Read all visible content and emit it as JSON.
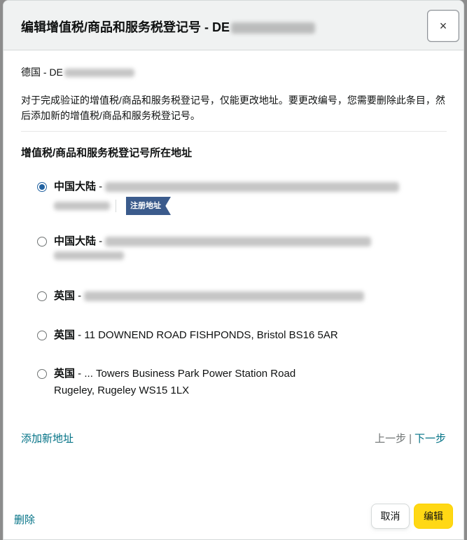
{
  "header": {
    "title": "编辑增值税/商品和服务税登记号 - DE",
    "close_glyph": "×"
  },
  "country_line": "德国 - DE",
  "note": "对于完成验证的增值税/商品和服务税登记号，仅能更改地址。要更改编号，您需要删除此条目，然后添加新的增值税/商品和服务税登记号。",
  "section_title": "增值税/商品和服务税登记号所在地址",
  "addresses": [
    {
      "country": "中国大陆",
      "dash": " - ",
      "line1": "106 ... Shenzhen, Guangdong",
      "selected": true,
      "badge": "注册地址"
    },
    {
      "country": "中国大陆",
      "dash": " - ",
      "line1": "... District",
      "selected": false
    },
    {
      "country": "英国",
      "dash": " - ",
      "line1": "... AVENUE ... RMS, Aberdeen ...",
      "selected": false
    },
    {
      "country": "英国",
      "dash": " - ",
      "line1": "11 DOWNEND ROAD FISHPONDS, Bristol BS16 5AR",
      "selected": false
    },
    {
      "country": "英国",
      "dash": " - ",
      "line1": "... Towers Business Park Power Station Road",
      "line2": "Rugeley, Rugeley WS15 1LX",
      "selected": false
    }
  ],
  "links": {
    "add_address": "添加新地址",
    "prev": "上一步",
    "separator": "|",
    "next": "下一步",
    "delete": "删除"
  },
  "buttons": {
    "cancel": "取消",
    "edit": "编辑"
  },
  "colors": {
    "primary_button": "#ffd814",
    "link": "#007185",
    "badge": "#3b5b8c",
    "radio_selected": "#2162a1"
  }
}
